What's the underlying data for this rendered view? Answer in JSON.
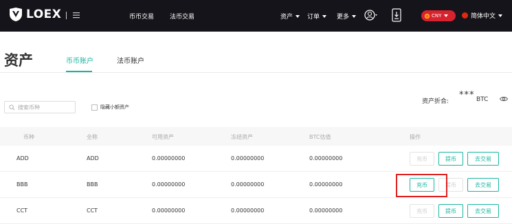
{
  "nav": {
    "logo_text": "LOEX",
    "links": [
      "币币交易",
      "法币交易"
    ],
    "assets": "资产",
    "orders": "订单",
    "more": "更多",
    "currency": "CNY",
    "language": "简体中文"
  },
  "page": {
    "title": "资产",
    "tabs": [
      {
        "label": "币币账户",
        "active": true
      },
      {
        "label": "法币账户",
        "active": false
      }
    ]
  },
  "filters": {
    "search_placeholder": "搜索币种",
    "hide_small_label": "隐藏小额资产"
  },
  "summary": {
    "label": "资产折合:",
    "value": "***",
    "unit": "BTC"
  },
  "table": {
    "headers": [
      "币种",
      "全称",
      "可用资产",
      "冻结资产",
      "BTC估值",
      "操作"
    ],
    "rows": [
      {
        "coin": "ADD",
        "name": "ADD",
        "available": "0.00000000",
        "frozen": "0.00000000",
        "btc": "0.00000000",
        "deposit_enabled": false
      },
      {
        "coin": "BBB",
        "name": "BBB",
        "available": "0.00000000",
        "frozen": "0.00000000",
        "btc": "0.00000000",
        "deposit_enabled": true,
        "withdraw_enabled": false
      },
      {
        "coin": "CCT",
        "name": "CCT",
        "available": "0.00000000",
        "frozen": "0.00000000",
        "btc": "0.00000000",
        "deposit_enabled": false
      }
    ],
    "actions": {
      "deposit": "充币",
      "withdraw": "提币",
      "trade": "去交易"
    }
  },
  "colors": {
    "accent": "#16b6a2",
    "nav_bg": "#15141a",
    "highlight": "#e02020"
  }
}
